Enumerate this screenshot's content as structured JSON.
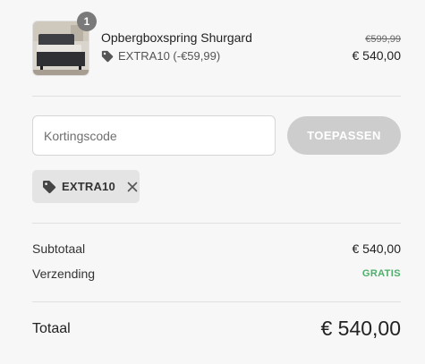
{
  "line_item": {
    "quantity": "1",
    "name": "Opbergboxspring Shurgard",
    "discount_text": "EXTRA10 (-€59,99)",
    "price_original": "€599,99",
    "price_final": "€ 540,00"
  },
  "discount_form": {
    "placeholder": "Kortingscode",
    "apply_label": "TOEPASSEN"
  },
  "applied_code": {
    "code": "EXTRA10"
  },
  "summary": {
    "subtotal_label": "Subtotaal",
    "subtotal_value": "€ 540,00",
    "shipping_label": "Verzending",
    "shipping_value": "GRATIS"
  },
  "total": {
    "label": "Totaal",
    "value": "€ 540,00"
  },
  "colors": {
    "free_shipping": "#4caf6a",
    "apply_button": "#cdcdcd",
    "chip_bg": "#e4e4e4"
  },
  "icons": [
    "tag-icon",
    "close-icon"
  ]
}
